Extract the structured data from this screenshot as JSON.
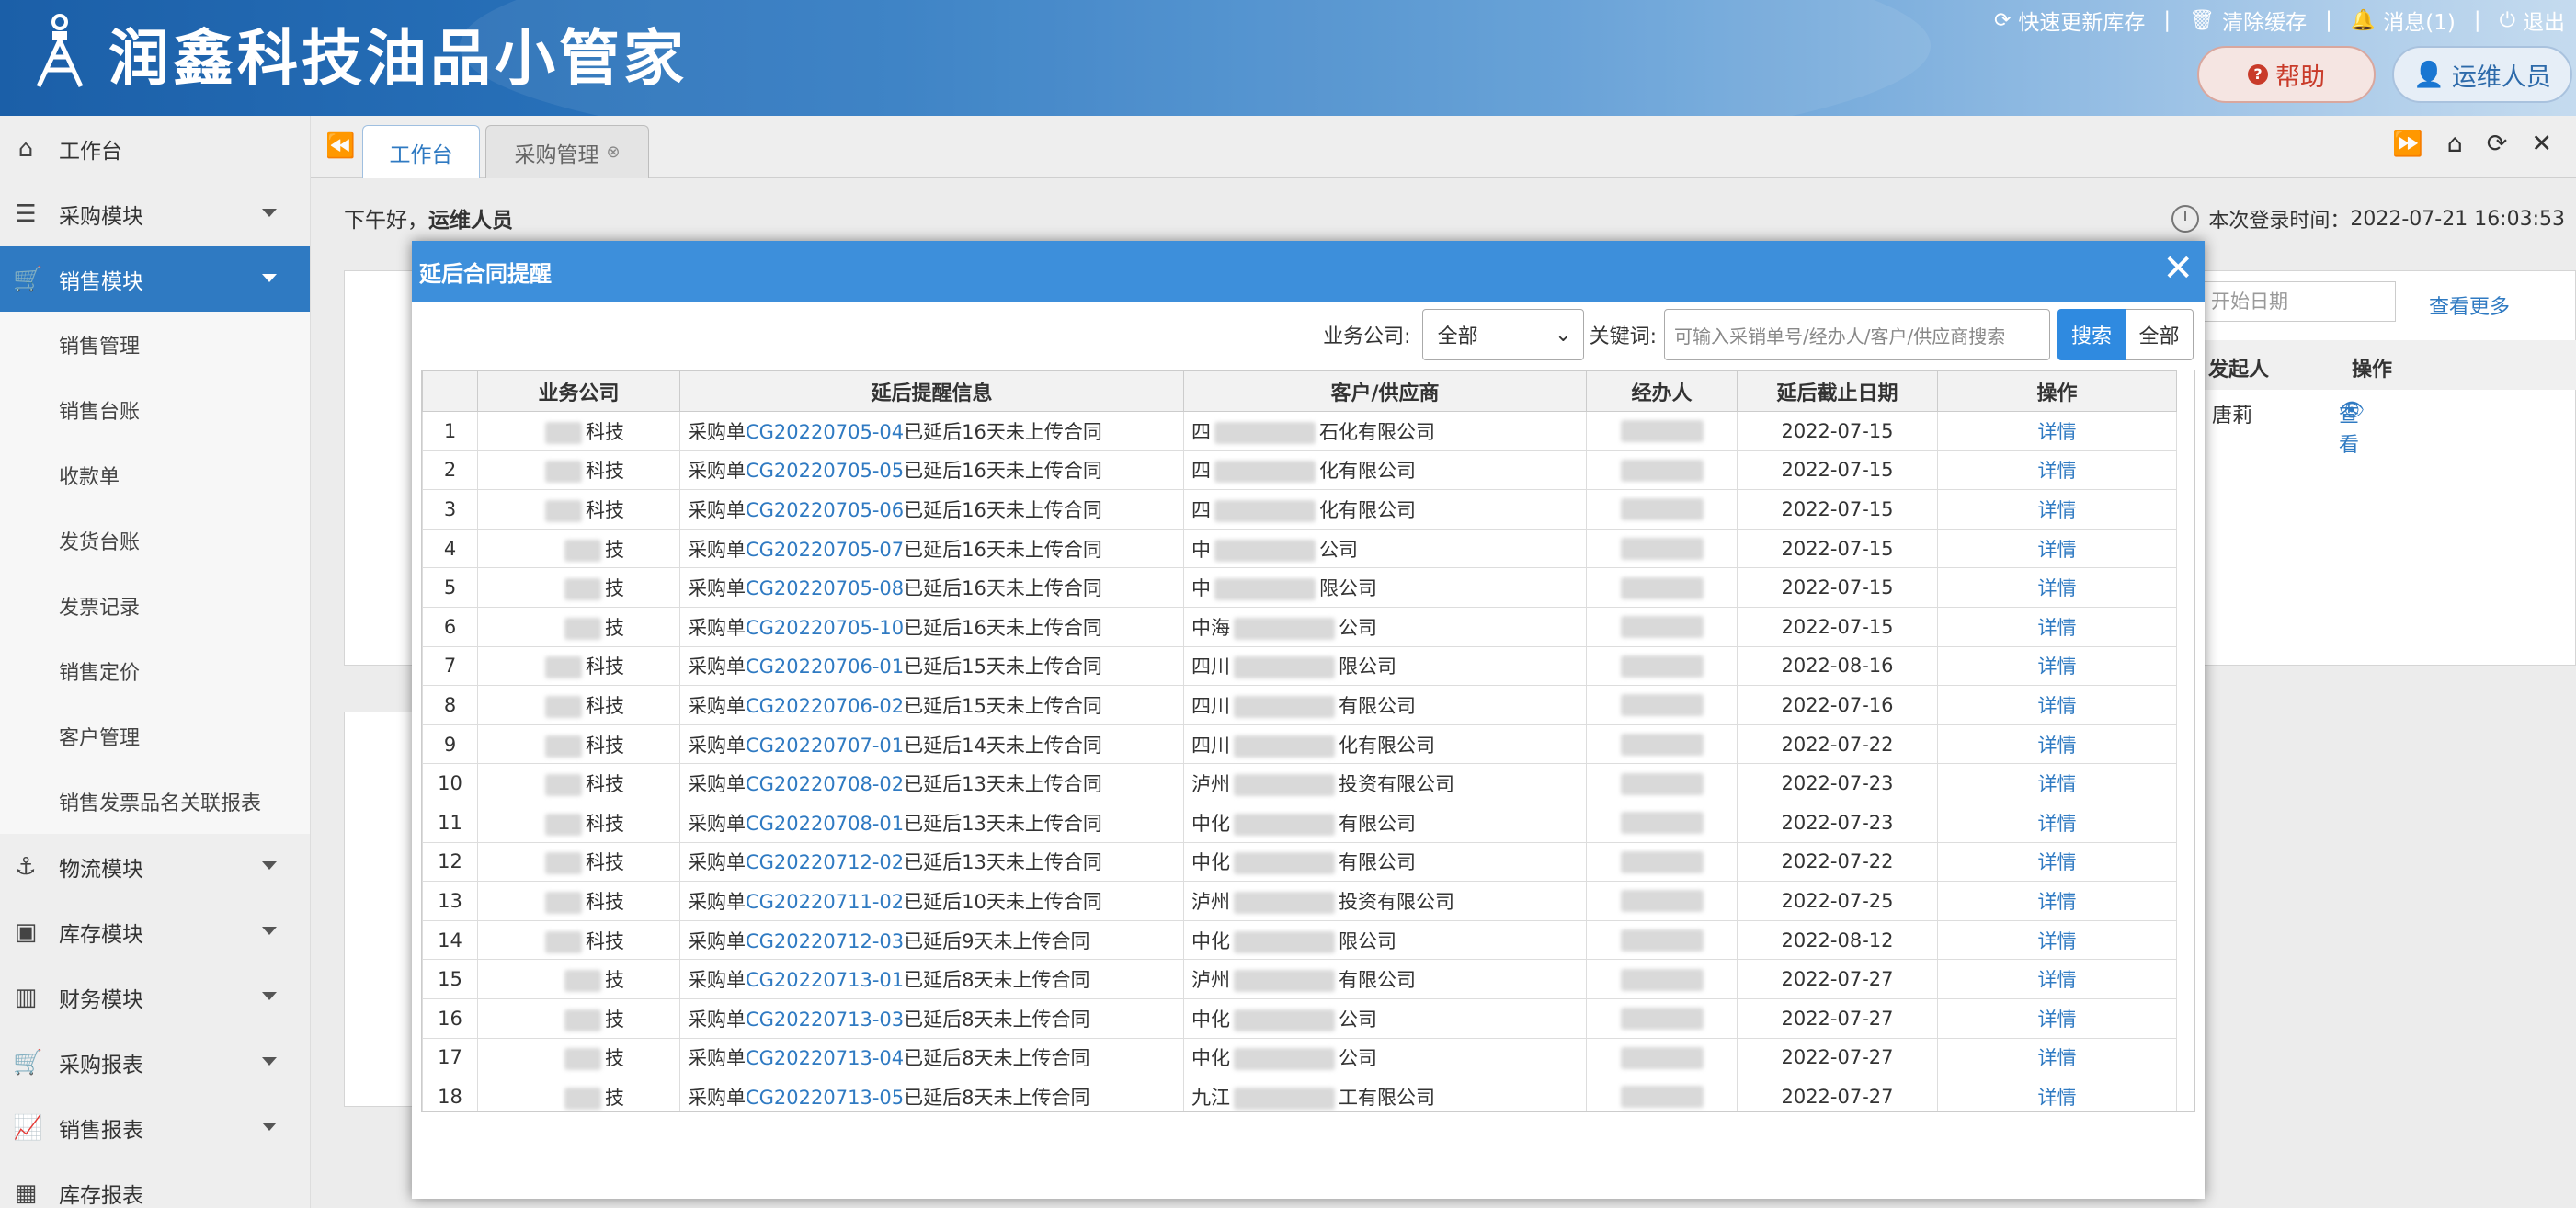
{
  "app": {
    "title": "润鑫科技油品小管家"
  },
  "toplinks": {
    "refresh": "快速更新库存",
    "clear_cache": "清除缓存",
    "messages": "消息(1)",
    "logout": "退出",
    "sep": "|"
  },
  "header_buttons": {
    "help": "帮助",
    "user": "运维人员"
  },
  "sidebar": {
    "workbench": "工作台",
    "procurement": "采购模块",
    "sales": "销售模块",
    "sales_sub": [
      "销售管理",
      "销售台账",
      "收款单",
      "发货台账",
      "发票记录",
      "销售定价",
      "客户管理",
      "销售发票品名关联报表"
    ],
    "logistics": "物流模块",
    "inventory": "库存模块",
    "finance": "财务模块",
    "purchase_report": "采购报表",
    "sales_report": "销售报表",
    "inventory_report": "库存报表"
  },
  "tabs": {
    "workbench": "工作台",
    "purchase_mgmt": "采购管理"
  },
  "page": {
    "greeting": "下午好，",
    "greeting_name": "运维人员",
    "login_time_label": "本次登录时间：",
    "login_time": "2022-07-21 16:03:53"
  },
  "right_panel": {
    "start_date_placeholder": "开始日期",
    "see_more": "查看更多",
    "col_initiator": "发起人",
    "col_action": "操作",
    "initiator": "唐莉",
    "view": "查看"
  },
  "modal": {
    "title": "延后合同提醒",
    "company_label": "业务公司:",
    "company_value": "全部",
    "keyword_label": "关键词:",
    "keyword_placeholder": "可输入采销单号/经办人/客户/供应商搜索",
    "search_btn": "搜索",
    "all_btn": "全部",
    "columns": [
      "业务公司",
      "延后提醒信息",
      "客户/供应商",
      "经办人",
      "延后截止日期",
      "操作"
    ],
    "rows": [
      {
        "no": "1",
        "company": "科技",
        "prefix": "采购单",
        "code": "CG20220705-04",
        "msg": "已延后16天未上传合同",
        "cust_a": "四",
        "cust_b": "石化有限公司",
        "date": "2022-07-15",
        "op": "详情"
      },
      {
        "no": "2",
        "company": "科技",
        "prefix": "采购单",
        "code": "CG20220705-05",
        "msg": "已延后16天未上传合同",
        "cust_a": "四",
        "cust_b": "化有限公司",
        "date": "2022-07-15",
        "op": "详情"
      },
      {
        "no": "3",
        "company": "科技",
        "prefix": "采购单",
        "code": "CG20220705-06",
        "msg": "已延后16天未上传合同",
        "cust_a": "四",
        "cust_b": "化有限公司",
        "date": "2022-07-15",
        "op": "详情"
      },
      {
        "no": "4",
        "company": "技",
        "prefix": "采购单",
        "code": "CG20220705-07",
        "msg": "已延后16天未上传合同",
        "cust_a": "中",
        "cust_b": "公司",
        "date": "2022-07-15",
        "op": "详情"
      },
      {
        "no": "5",
        "company": "技",
        "prefix": "采购单",
        "code": "CG20220705-08",
        "msg": "已延后16天未上传合同",
        "cust_a": "中",
        "cust_b": "限公司",
        "date": "2022-07-15",
        "op": "详情"
      },
      {
        "no": "6",
        "company": "技",
        "prefix": "采购单",
        "code": "CG20220705-10",
        "msg": "已延后16天未上传合同",
        "cust_a": "中海",
        "cust_b": "公司",
        "date": "2022-07-15",
        "op": "详情"
      },
      {
        "no": "7",
        "company": "科技",
        "prefix": "采购单",
        "code": "CG20220706-01",
        "msg": "已延后15天未上传合同",
        "cust_a": "四川",
        "cust_b": "限公司",
        "date": "2022-08-16",
        "op": "详情"
      },
      {
        "no": "8",
        "company": "科技",
        "prefix": "采购单",
        "code": "CG20220706-02",
        "msg": "已延后15天未上传合同",
        "cust_a": "四川",
        "cust_b": "有限公司",
        "date": "2022-07-16",
        "op": "详情"
      },
      {
        "no": "9",
        "company": "科技",
        "prefix": "采购单",
        "code": "CG20220707-01",
        "msg": "已延后14天未上传合同",
        "cust_a": "四川",
        "cust_b": "化有限公司",
        "date": "2022-07-22",
        "op": "详情"
      },
      {
        "no": "10",
        "company": "科技",
        "prefix": "采购单",
        "code": "CG20220708-02",
        "msg": "已延后13天未上传合同",
        "cust_a": "泸州",
        "cust_b": "投资有限公司",
        "date": "2022-07-23",
        "op": "详情"
      },
      {
        "no": "11",
        "company": "科技",
        "prefix": "采购单",
        "code": "CG20220708-01",
        "msg": "已延后13天未上传合同",
        "cust_a": "中化",
        "cust_b": "有限公司",
        "date": "2022-07-23",
        "op": "详情"
      },
      {
        "no": "12",
        "company": "科技",
        "prefix": "采购单",
        "code": "CG20220712-02",
        "msg": "已延后13天未上传合同",
        "cust_a": "中化",
        "cust_b": "有限公司",
        "date": "2022-07-22",
        "op": "详情"
      },
      {
        "no": "13",
        "company": "科技",
        "prefix": "采购单",
        "code": "CG20220711-02",
        "msg": "已延后10天未上传合同",
        "cust_a": "泸州",
        "cust_b": "投资有限公司",
        "date": "2022-07-25",
        "op": "详情"
      },
      {
        "no": "14",
        "company": "科技",
        "prefix": "采购单",
        "code": "CG20220712-03",
        "msg": "已延后9天未上传合同",
        "cust_a": "中化",
        "cust_b": "限公司",
        "date": "2022-08-12",
        "op": "详情"
      },
      {
        "no": "15",
        "company": "技",
        "prefix": "采购单",
        "code": "CG20220713-01",
        "msg": "已延后8天未上传合同",
        "cust_a": "泸州",
        "cust_b": "有限公司",
        "date": "2022-07-27",
        "op": "详情"
      },
      {
        "no": "16",
        "company": "技",
        "prefix": "采购单",
        "code": "CG20220713-03",
        "msg": "已延后8天未上传合同",
        "cust_a": "中化",
        "cust_b": "公司",
        "date": "2022-07-27",
        "op": "详情"
      },
      {
        "no": "17",
        "company": "技",
        "prefix": "采购单",
        "code": "CG20220713-04",
        "msg": "已延后8天未上传合同",
        "cust_a": "中化",
        "cust_b": "公司",
        "date": "2022-07-27",
        "op": "详情"
      },
      {
        "no": "18",
        "company": "技",
        "prefix": "采购单",
        "code": "CG20220713-05",
        "msg": "已延后8天未上传合同",
        "cust_a": "九江",
        "cust_b": "工有限公司",
        "date": "2022-07-27",
        "op": "详情"
      }
    ]
  },
  "colors": {
    "primary": "#2f7ac2",
    "modal_header": "#3d8fdb",
    "help_text": "#c93b2a"
  }
}
